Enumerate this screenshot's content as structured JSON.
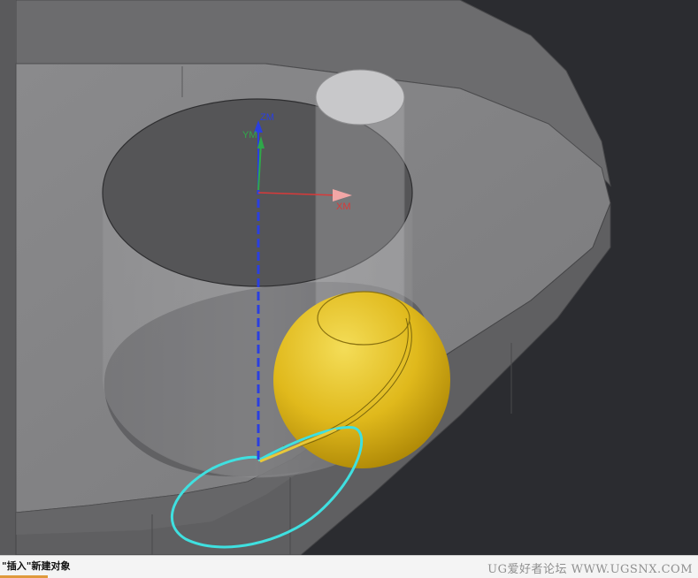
{
  "viewport": {
    "background": "#2b2c30",
    "axes": {
      "z_label": "ZM",
      "y_label": "YM",
      "x_label": "XM",
      "z_color": "#2a3fe0",
      "y_color": "#2fa84a",
      "x_color": "#d83a3a"
    },
    "sphere_color": "#e2bd1e",
    "curve_color": "#3fe0e0"
  },
  "statusbar": {
    "message": "\"插入\"新建对象",
    "watermark": "UG爱好者论坛 WWW.UGSNX.COM"
  }
}
